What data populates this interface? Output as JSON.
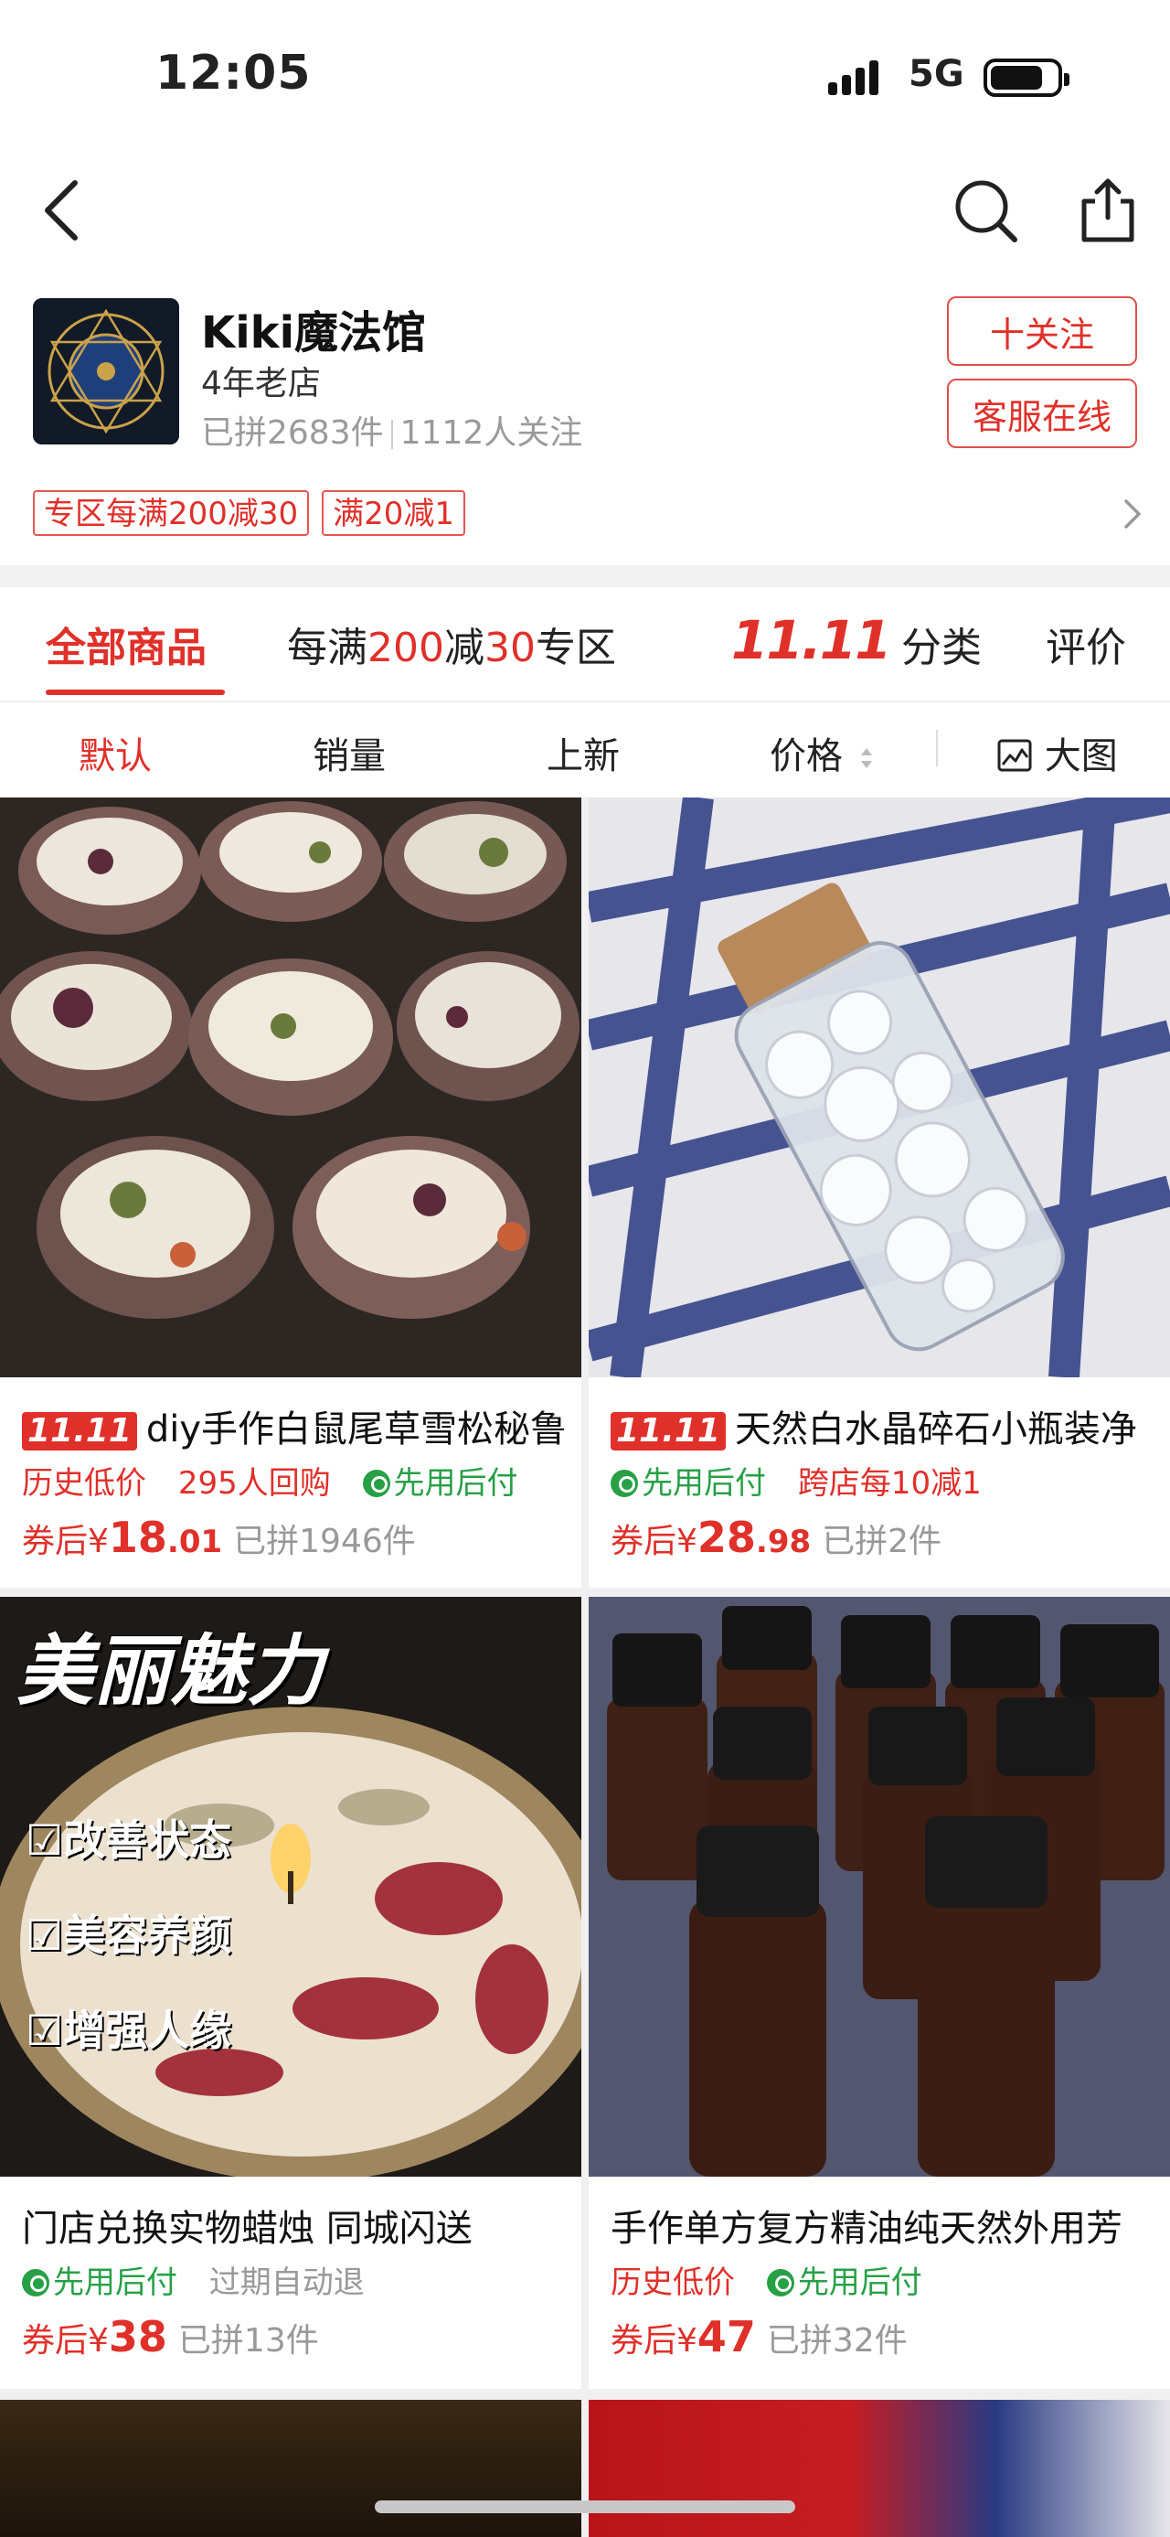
{
  "status_bar": {
    "time": "12:05",
    "network": "5G"
  },
  "shop": {
    "name": "Kiki魔法馆",
    "age": "4年老店",
    "stats_joined": "已拼2683件",
    "stats_followers": "1112人关注",
    "follow_label": "十关注",
    "service_label": "客服在线",
    "coupons": [
      "专区每满200减30",
      "满20减1"
    ]
  },
  "tabs": {
    "all": "全部商品",
    "promo_prefix": "每满",
    "promo_amount1": "200",
    "promo_mid": "减",
    "promo_amount2": "30",
    "promo_suffix": "专区",
    "double11": "11.11",
    "category": "分类",
    "reviews": "评价"
  },
  "sort": {
    "default": "默认",
    "sales": "销量",
    "new": "上新",
    "price": "价格",
    "big_image": "大图"
  },
  "products": [
    {
      "badge": "11.11",
      "title": "diy手作白鼠尾草雪松秘鲁",
      "tags": [
        {
          "text": "历史低价",
          "style": "red"
        },
        {
          "text": "295人回购",
          "style": "red"
        },
        {
          "text": "先用后付",
          "style": "green"
        }
      ],
      "price_prefix": "券后¥",
      "price_int": "18",
      "price_dec": ".01",
      "sold": "已拼1946件"
    },
    {
      "badge": "11.11",
      "title": "天然白水晶碎石小瓶装净",
      "tags": [
        {
          "text": "先用后付",
          "style": "green"
        },
        {
          "text": "跨店每10减1",
          "style": "red"
        }
      ],
      "price_prefix": "券后¥",
      "price_int": "28",
      "price_dec": ".98",
      "sold": "已拼2件"
    },
    {
      "badge": "",
      "title": "门店兑换实物蜡烛 同城闪送",
      "image_text": "美丽魅力",
      "image_checks": [
        "改善状态",
        "美容养颜",
        "增强人缘"
      ],
      "tags": [
        {
          "text": "先用后付",
          "style": "green"
        },
        {
          "text": "过期自动退",
          "style": "gray"
        }
      ],
      "price_prefix": "券后¥",
      "price_int": "38",
      "price_dec": "",
      "sold": "已拼13件"
    },
    {
      "badge": "",
      "title": "手作单方复方精油纯天然外用芳",
      "tags": [
        {
          "text": "历史低价",
          "style": "red"
        },
        {
          "text": "先用后付",
          "style": "green"
        }
      ],
      "price_prefix": "券后¥",
      "price_int": "47",
      "price_dec": "",
      "sold": "已拼32件"
    }
  ],
  "colors": {
    "accent": "#e0302a",
    "green": "#27a046",
    "muted": "#999999"
  }
}
